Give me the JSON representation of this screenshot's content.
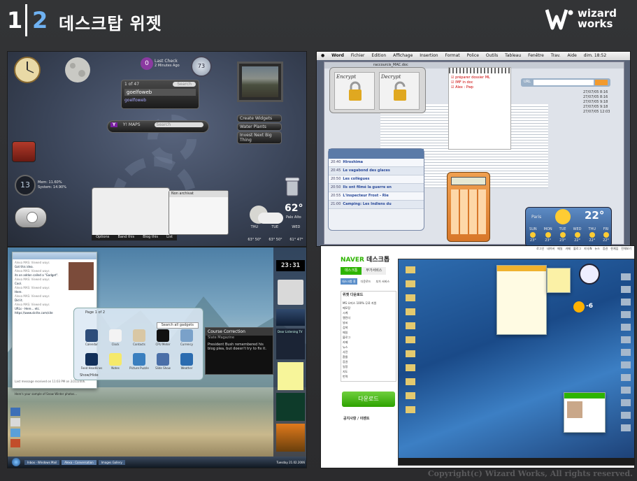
{
  "header": {
    "page_number_major": "1",
    "page_number_minor": "2",
    "title": "데스크탑 위젯",
    "logo_line1": "wizard",
    "logo_line2": "works"
  },
  "copyright": "Copyright(c) Wizard Works, All rights reserved.",
  "panel_yahoo": {
    "last_check": "Last Check",
    "minutes_ago": "2 Minutes Ago",
    "badge_count": "0",
    "disk_value": "73",
    "search_placeholder": "Search",
    "feed_counter": "1 of 47",
    "feed_user": "goelfoweb",
    "feed_sub": "goelfoweb",
    "yahoo_brand": "Y! MAPS",
    "yahoo_search": "Search",
    "widget_links": [
      "Create Widgets",
      "Water Plants",
      "Invest Next Big Thing"
    ],
    "battery_line1": "Mem: 11.60%",
    "battery_line2": "System: 14.90%",
    "battery_number": "13",
    "notes_title": "Non archivat",
    "bottom_bar": [
      "Options",
      "Band this",
      "Blog this",
      "List"
    ],
    "weather_temp": "62°",
    "weather_city": "Palo Alto",
    "forecast_days": [
      "THU",
      "TUE",
      "WED"
    ],
    "forecast_temps": [
      "63° 50°",
      "63° 50°",
      "61° 47°"
    ]
  },
  "panel_mac": {
    "menu": [
      "Word",
      "Fichier",
      "Edition",
      "Affichage",
      "Insertion",
      "Format",
      "Police",
      "Outils",
      "Tableau",
      "Fenêtre",
      "Trav.",
      "Aide",
      "dim. 18:52"
    ],
    "doc_title": "raccourcis_MAC.doc",
    "encrypt": "Encrypt",
    "decrypt": "Decrypt",
    "checklist": [
      "préparer dossier ML",
      "IMF in doc",
      "Alex : Pwp"
    ],
    "url_label": "URL",
    "tv_rows": [
      {
        "time": "20:40",
        "title": "Hiroshima"
      },
      {
        "time": "20:45",
        "title": "Le vagabond des glaces"
      },
      {
        "time": "20:50",
        "title": "Les collègues"
      },
      {
        "time": "20:50",
        "title": "Ils ont filmé la guerre en"
      },
      {
        "time": "20:55",
        "title": "L'inspecteur Frost - Rie"
      },
      {
        "time": "21:00",
        "title": "Camping: Les Indiens du"
      }
    ],
    "weather_city": "Paris",
    "weather_temp": "22°",
    "forecast_days": [
      "SUN",
      "MON",
      "TUE",
      "WED",
      "THU",
      "FRI"
    ],
    "forecast_temps": [
      "23°",
      "23°",
      "23°",
      "22°",
      "22°",
      "22°"
    ],
    "dates": [
      "27/07/05 8:16",
      "27/07/05 8:16",
      "27/07/05 9:18",
      "27/07/05 9:18",
      "27/07/05 12:03"
    ]
  },
  "panel_vista": {
    "clock": "23:31",
    "gadget_title": "Page 1 of 2",
    "gadgets": [
      "Calendar",
      "Clock",
      "Contacts",
      "CPU Meter",
      "Currency",
      "Feed Headlines",
      "Notes",
      "Picture Puzzle",
      "Slide Show",
      "Weather"
    ],
    "search_gadgets": "Search all gadgets",
    "news_title": "Course Correction",
    "news_sub": "Slate Magazine",
    "news_body": "President Bush remembered his blog plea, but doesn't try to fix it.",
    "sidebar_title": "Dear Listening TV",
    "taskbar_items": [
      "Inbox - Windows Mail",
      "Alexa - Conversation",
      "Images Gallery"
    ],
    "taskbar_time": "Tuesday 21.02.2006",
    "messenger_text": [
      "Alexa MAS: Viewed ways",
      "Got this idea.",
      "Alexa MAS: Viewed ways",
      "its on addon called a \"Gadget\".",
      "Alexa MAS: Viewed ways",
      "Cool.",
      "Alexa MAS: Viewed ways",
      "Here.",
      "Alexa MAS: Viewed ways",
      "Did it.",
      "Alexa MAS: Viewed ways",
      "URLs - Here... etc.",
      "https://www.skrite.com/site"
    ],
    "last_message": "Last message received on 11:03 PM on 2/21/2006.",
    "mail_footer": "Here's your sample of Snow Winter photos...",
    "show_sidebar": "Show/Hide"
  },
  "panel_naver": {
    "brand": "NAVER",
    "app": "데스크톱",
    "top_links": [
      "로그인",
      "네이버",
      "메일",
      "카페",
      "블로그",
      "지식iN",
      "뉴스",
      "증권",
      "한게임",
      "전체보기"
    ],
    "tabs": [
      "데스크톱",
      "부가서비스"
    ],
    "subtabs": [
      "데스크톱 홈",
      "다운로드",
      "부가 서비스"
    ],
    "list_title": "위젯 다운로드",
    "list_more": "더보기",
    "widget_items": [
      "MS 오피스 100% 무료 지원",
      "메모장",
      "시계",
      "캘린더",
      "날씨",
      "검색",
      "메일",
      "블로그",
      "카페",
      "뉴스",
      "사전",
      "환율",
      "증권",
      "일정",
      "지도",
      "번역"
    ],
    "download_label": "다운로드",
    "notice_title": "공지사항 / 이벤트",
    "weather_temp": "-6",
    "messenger_title": "친구 목록"
  },
  "colors": {
    "accent_blue": "#6fb2f2",
    "background": "#2f2f31",
    "naver_green": "#2db400",
    "vista_blue": "#4d7fa6"
  }
}
